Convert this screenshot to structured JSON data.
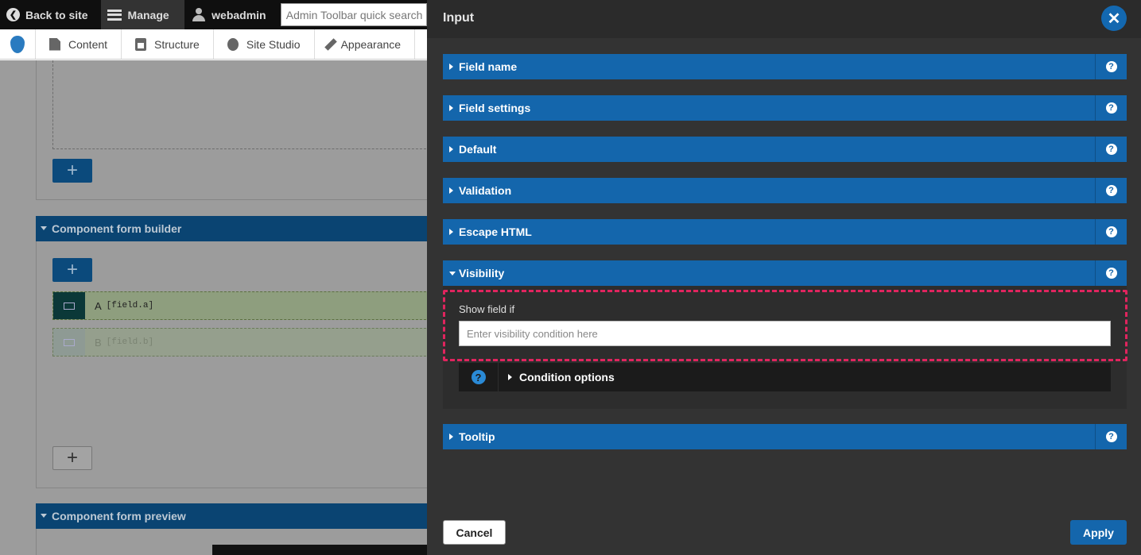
{
  "toolbar": {
    "back_label": "Back to site",
    "manage_label": "Manage",
    "user_label": "webadmin",
    "search_placeholder": "Admin Toolbar quick search",
    "menu": [
      {
        "label": "Content",
        "icon": "document-icon"
      },
      {
        "label": "Structure",
        "icon": "structure-icon"
      },
      {
        "label": "Site Studio",
        "icon": "site-studio-icon"
      },
      {
        "label": "Appearance",
        "icon": "appearance-icon"
      }
    ]
  },
  "page": {
    "form_builder_title": "Component form builder",
    "form_preview_title": "Component form preview",
    "add_label": "+",
    "fields": [
      {
        "label": "A",
        "key": "[field.a]"
      },
      {
        "label": "B",
        "key": "[field.b]"
      }
    ]
  },
  "modal": {
    "title": "Input",
    "close_label": "✕",
    "help_label": "?",
    "sections": [
      {
        "title": "Field name"
      },
      {
        "title": "Field settings"
      },
      {
        "title": "Default"
      },
      {
        "title": "Validation"
      },
      {
        "title": "Escape HTML"
      },
      {
        "title": "Visibility"
      },
      {
        "title": "Tooltip"
      }
    ],
    "visibility": {
      "show_field_label": "Show field if",
      "input_placeholder": "Enter visibility condition here",
      "condition_options_label": "Condition options"
    },
    "cancel_label": "Cancel",
    "apply_label": "Apply"
  },
  "colors": {
    "accent": "#1466ac",
    "highlight": "#e0245e",
    "modal_bg": "#333333"
  }
}
